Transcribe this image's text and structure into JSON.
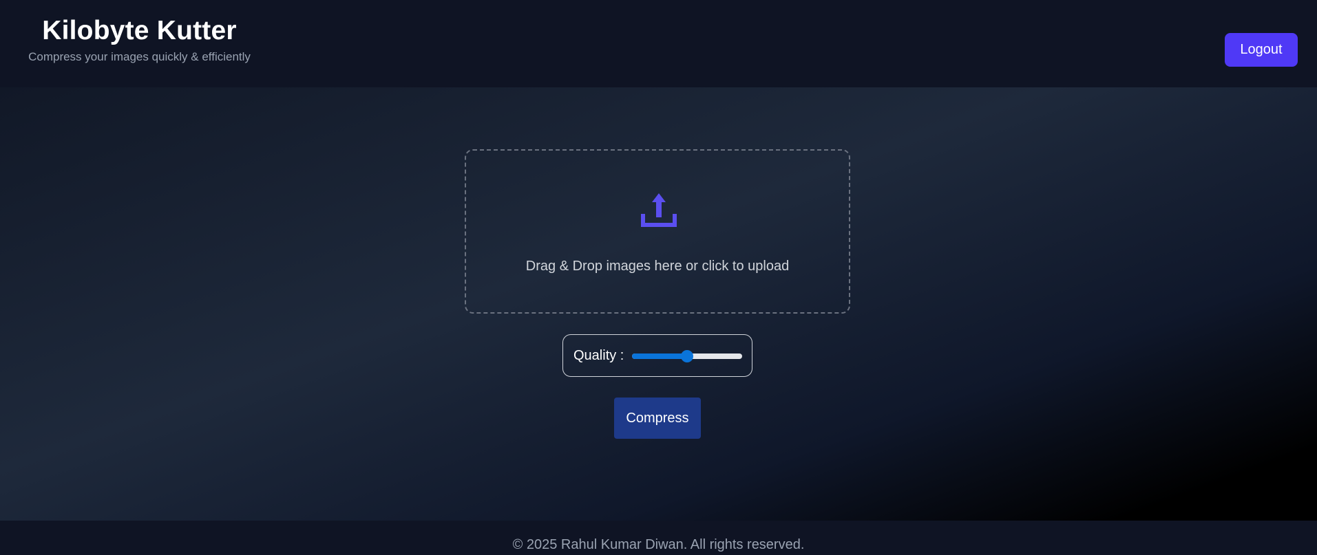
{
  "header": {
    "title": "Kilobyte Kutter",
    "subtitle": "Compress your images quickly & efficiently",
    "logout_label": "Logout"
  },
  "upload": {
    "icon": "upload-icon",
    "prompt": "Drag & Drop images here or click to upload"
  },
  "quality": {
    "label": "Quality :",
    "value_fraction": 0.5
  },
  "actions": {
    "compress_label": "Compress"
  },
  "footer": {
    "copyright": "© 2025 Rahul Kumar Diwan. All rights reserved."
  },
  "colors": {
    "accent": "#4f39f6",
    "compress_button": "#1e3a8a",
    "slider": "#0a74da",
    "upload_icon": "#5b4ff0"
  }
}
